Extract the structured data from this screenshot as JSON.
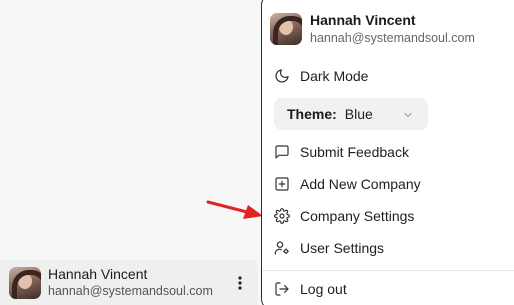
{
  "user": {
    "name": "Hannah Vincent",
    "email": "hannah@systemandsoul.com"
  },
  "menu": {
    "header": {
      "name": "Hannah Vincent",
      "email": "hannah@systemandsoul.com"
    },
    "dark_mode_label": "Dark Mode",
    "theme": {
      "label": "Theme:",
      "value": "Blue"
    },
    "submit_feedback_label": "Submit Feedback",
    "add_company_label": "Add New Company",
    "company_settings_label": "Company Settings",
    "user_settings_label": "User Settings",
    "logout_label": "Log out"
  },
  "icons": {
    "dark_mode": "moon-icon",
    "feedback": "message-square-icon",
    "add_company": "plus-square-icon",
    "company_settings": "gear-icon",
    "user_settings": "user-cog-icon",
    "logout": "log-out-icon",
    "more": "more-vertical-icon",
    "theme_dropdown": "chevron-down-icon"
  },
  "colors": {
    "annotation_arrow": "#e02424",
    "menu_border": "#2a2a2a"
  }
}
